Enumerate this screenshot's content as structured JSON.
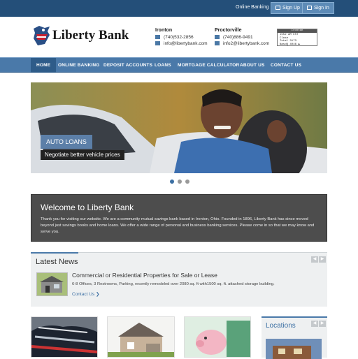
{
  "topbar": {
    "online_banking": "Online Banking",
    "sign_up": "Sign Up",
    "sign_in": "Sign In"
  },
  "brand": {
    "name": "Liberty Bank"
  },
  "branches": [
    {
      "name": "Ironton",
      "phone": "(740)532-2856",
      "email": "info@libertybank.com"
    },
    {
      "name": "Proctorville",
      "phone": "(740)886-9491",
      "email": "info2@libertybank.com"
    }
  ],
  "ticker": {
    "title": "Ironton",
    "lines": [
      "1552 AM EST",
      "Close",
      "Total 3173",
      "NasdQ 4046 ▲",
      "SP5 1884 ▲"
    ]
  },
  "nav": [
    "HOME",
    "ONLINE BANKING",
    "DEPOSIT ACCOUNTS",
    "LOANS",
    "MORTGAGE CALCULATOR",
    "ABOUT US",
    "CONTACT US"
  ],
  "slider": {
    "caption_title": "AUTO LOANS",
    "caption_text": "Negotiate better vehicle prices",
    "active_slide": 1,
    "slide_count": 3
  },
  "welcome": {
    "title": "Welcome to Liberty Bank",
    "text": "Thank you for visiting our website. We are a community mutual savings bank based in Ironton, Ohio. Founded in 1896, Liberty Bank has since moved beyond just savings books and home loans. We offer a wide range of personal and business banking services. Please come in so that we may know and serve you."
  },
  "news": {
    "heading": "Latest News",
    "item_title": "Commercial or Residential Properties for Sale or Lease",
    "item_desc": "6-8 Offices, 3 Restrooms, Parking, recently remodeled over 2080 sq. ft with1500 sq. ft. attached storage building.",
    "cta": "Contact Us ❯"
  },
  "locations": {
    "heading": "Locations"
  },
  "colors": {
    "topbar": "#244f79",
    "nav": "#4a79a9",
    "accent": "#3b6fa3"
  }
}
